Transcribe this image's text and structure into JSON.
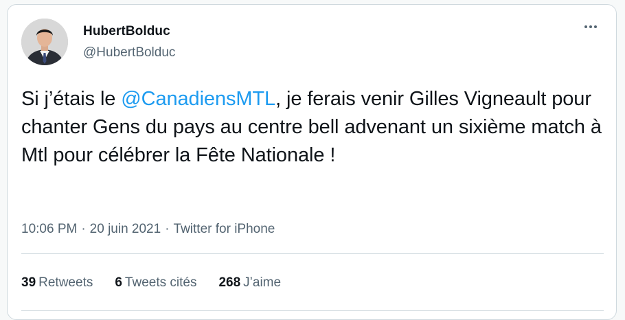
{
  "author": {
    "name": "HubertBolduc",
    "handle": "@HubertBolduc"
  },
  "tweet": {
    "text_before": "Si j’étais le ",
    "mention": "@CanadiensMTL",
    "text_after": ",  je ferais venir Gilles Vigneault pour chanter Gens du pays au centre bell advenant un sixième match à Mtl pour célébrer la Fête Nationale !"
  },
  "meta": {
    "time": "10:06 PM",
    "separator": "·",
    "date": "20 juin 2021",
    "source": "Twitter for iPhone"
  },
  "stats": {
    "retweets_count": "39",
    "retweets_label": "Retweets",
    "quotes_count": "6",
    "quotes_label": "Tweets cités",
    "likes_count": "268",
    "likes_label": "J’aime"
  },
  "colors": {
    "link": "#1d9bf0",
    "secondary_text": "#536471",
    "primary_text": "#0f1419"
  },
  "icons": {
    "more": "more-horizontal-icon"
  }
}
